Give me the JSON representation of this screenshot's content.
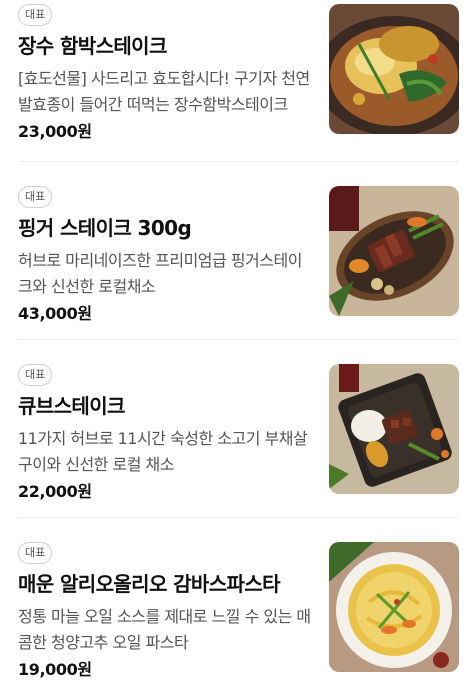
{
  "menu": {
    "items": [
      {
        "badge": "대표",
        "name": "장수 함박스테이크",
        "description": "[효도선물] 사드리고 효도합시다! 구기자 천연발효종이 들어간 떠먹는 장수함박스테이크",
        "price": "23,000원"
      },
      {
        "badge": "대표",
        "name": "핑거 스테이크 300g",
        "description": "허브로 마리네이즈한 프리미엄급 핑거스테이크와 신선한 로컬채소",
        "price": "43,000원"
      },
      {
        "badge": "대표",
        "name": "큐브스테이크",
        "description": "11가지 허브로 11시간 숙성한 소고기 부채살 구이와 신선한 로컬 채소",
        "price": "22,000원"
      },
      {
        "badge": "대표",
        "name": "매운 알리오올리오 감바스파스타",
        "description": "정통 마늘 오일 소스를 제대로 느낄 수 있는 매콤한 청양고추 오일 파스타",
        "price": "19,000원"
      }
    ]
  }
}
